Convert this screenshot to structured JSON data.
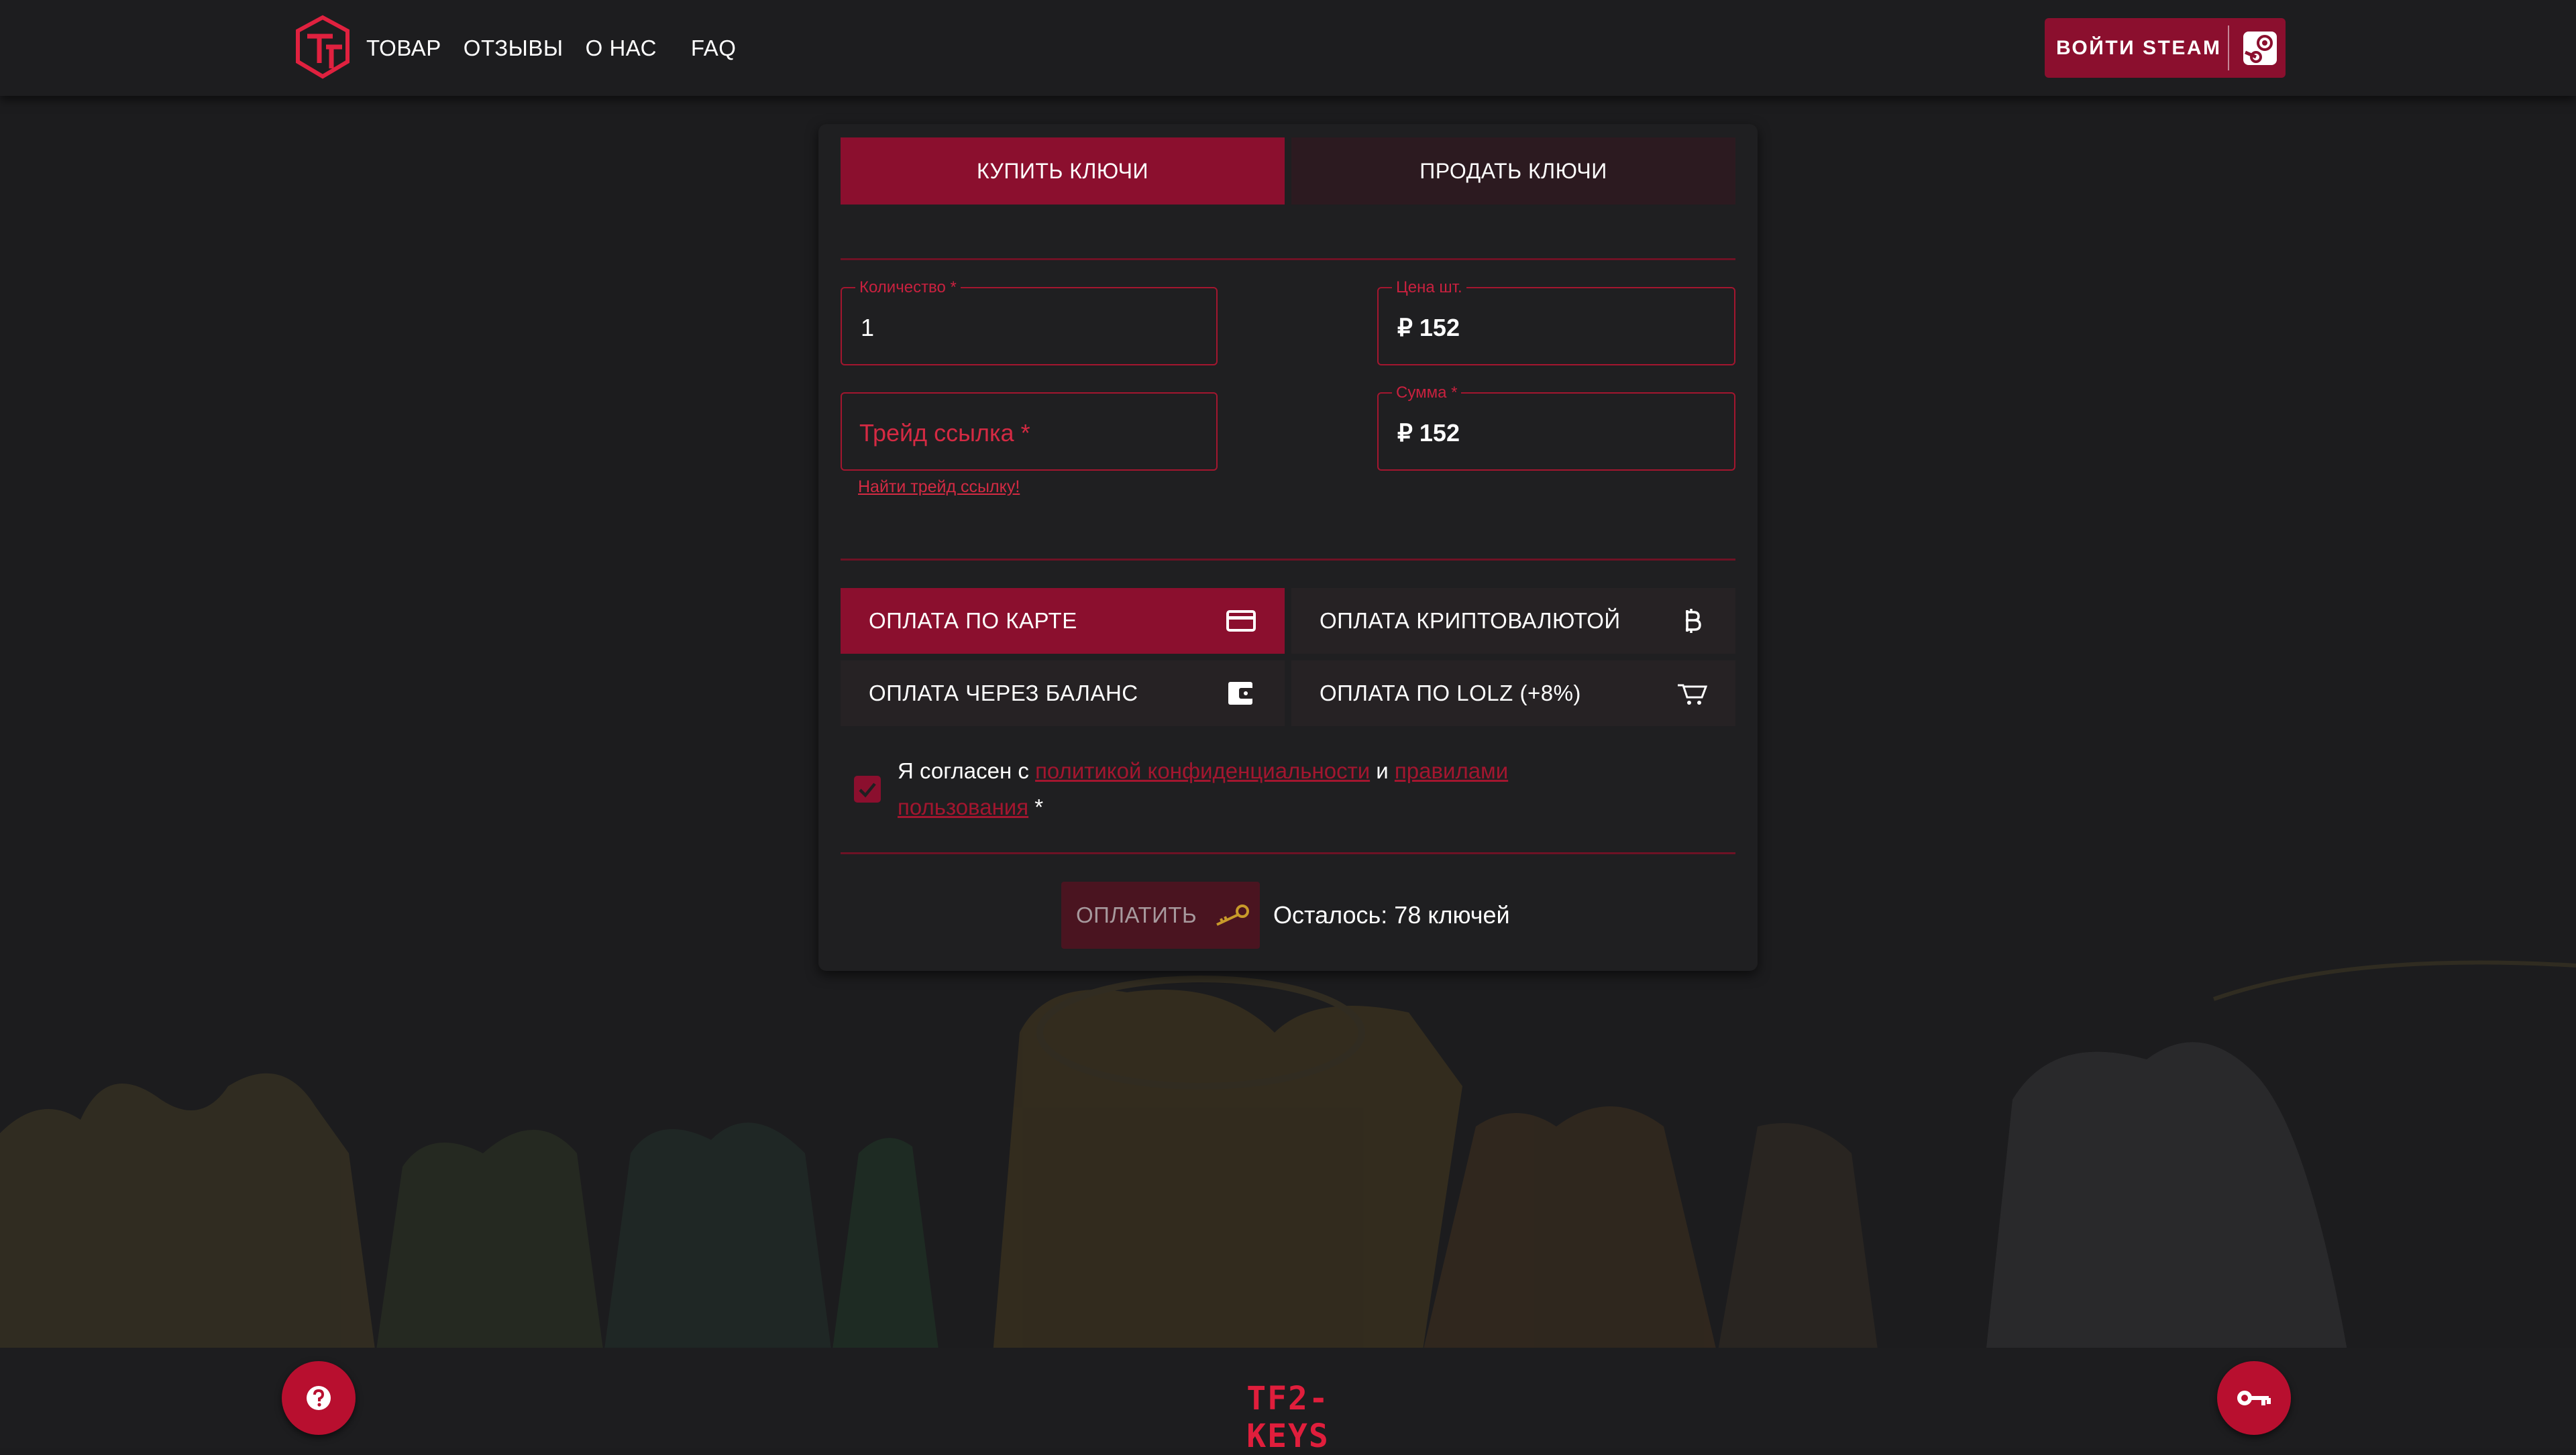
{
  "header": {
    "nav": [
      "ТОВАР",
      "ОТЗЫВЫ",
      "О НАС",
      "FAQ"
    ],
    "steam_button": "ВОЙТИ STEAM"
  },
  "tabs": {
    "buy": "КУПИТЬ КЛЮЧИ",
    "sell": "ПРОДАТЬ КЛЮЧИ",
    "active": "buy"
  },
  "form": {
    "quantity": {
      "label": "Количество *",
      "value": "1"
    },
    "unit_price": {
      "label": "Цена шт.",
      "value": "₽  152"
    },
    "trade_link": {
      "placeholder": "Трейд ссылка *",
      "helper": "Найти трейд ссылку!"
    },
    "total": {
      "label": "Сумма *",
      "value": "₽  152"
    }
  },
  "payment": {
    "card": {
      "label": "ОПЛАТА ПО КАРТЕ",
      "icon": "credit-card-icon",
      "selected": true
    },
    "crypto": {
      "label": "ОПЛАТА КРИПТОВАЛЮТОЙ",
      "icon": "bitcoin-icon",
      "selected": false
    },
    "balance": {
      "label": "ОПЛАТА ЧЕРЕЗ БАЛАНС",
      "icon": "wallet-icon",
      "selected": false
    },
    "lolz": {
      "label": "ОПЛАТА ПО LOLZ (+8%)",
      "icon": "cart-icon",
      "selected": false
    }
  },
  "agreement": {
    "prefix": "Я согласен с ",
    "privacy_link": "политикой конфиденциальности",
    "and": " и ",
    "rules_link": "правилами пользования",
    "suffix": " *",
    "checked": true
  },
  "submit": {
    "label": "ОПЛАТИТЬ",
    "remaining": "Осталось: 78 ключей"
  },
  "footer": {
    "brand": "TF2-KEYS"
  },
  "colors": {
    "accent": "#8b0f2e",
    "error": "#d42a43",
    "background": "#1c1c1e",
    "fab": "#b80f2f"
  }
}
